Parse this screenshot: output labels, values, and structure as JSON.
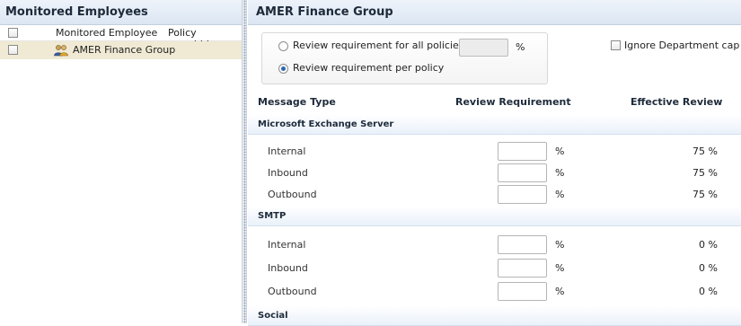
{
  "left_pane": {
    "title": "Monitored Employees",
    "columns": {
      "employee": "Monitored Employee",
      "policy": "Policy overridden"
    },
    "rows": [
      {
        "label": "AMER Finance Group",
        "icon": "group-icon",
        "selected": true
      }
    ]
  },
  "right_pane": {
    "title": "AMER Finance Group",
    "options": {
      "all_policies_label": "Review requirement for all policies",
      "all_policies_value": "",
      "all_policies_unit": "%",
      "per_policy_label": "Review requirement per policy",
      "selected": "per_policy"
    },
    "ignore_department_cap": {
      "label": "Ignore Department cap",
      "checked": false
    },
    "table": {
      "headers": {
        "type": "Message Type",
        "requirement": "Review Requirement",
        "effective": "Effective Review"
      },
      "sections": [
        {
          "name": "Microsoft Exchange Server",
          "rows": [
            {
              "label": "Internal",
              "requirement": "",
              "unit": "%",
              "effective": "75 %"
            },
            {
              "label": "Inbound",
              "requirement": "",
              "unit": "%",
              "effective": "75 %"
            },
            {
              "label": "Outbound",
              "requirement": "",
              "unit": "%",
              "effective": "75 %"
            }
          ]
        },
        {
          "name": "SMTP",
          "rows": [
            {
              "label": "Internal",
              "requirement": "",
              "unit": "%",
              "effective": "0 %"
            },
            {
              "label": "Inbound",
              "requirement": "",
              "unit": "%",
              "effective": "0 %"
            },
            {
              "label": "Outbound",
              "requirement": "",
              "unit": "%",
              "effective": "0 %"
            }
          ]
        },
        {
          "name": "Social",
          "rows": []
        }
      ]
    }
  },
  "colors": {
    "header_gradient_top": "#eef3fa",
    "header_gradient_bottom": "#dbe6f3",
    "selected_row": "#f0ead4",
    "radio_dot": "#2f66b3"
  }
}
